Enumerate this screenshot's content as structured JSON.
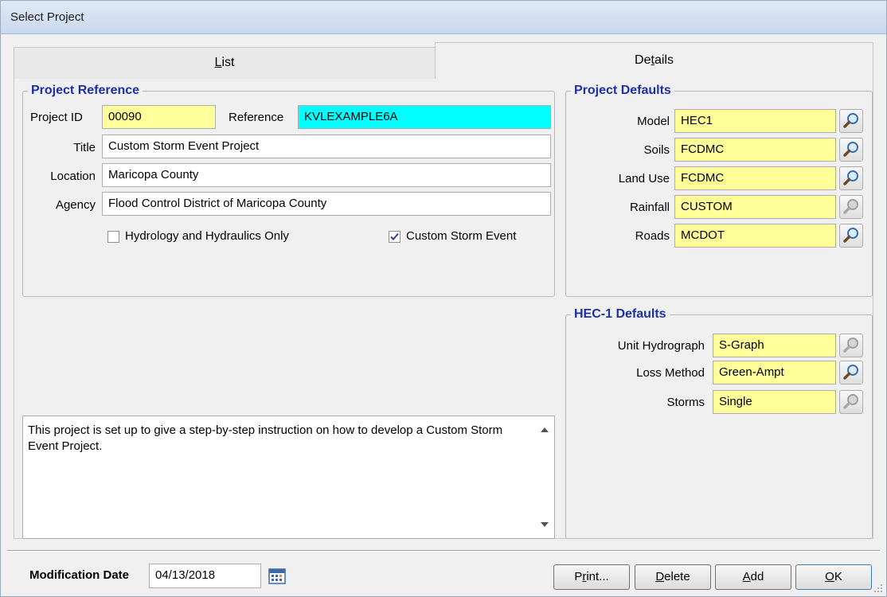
{
  "window": {
    "title": "Select Project"
  },
  "tabs": {
    "list": "List",
    "details": "Details"
  },
  "project_reference": {
    "legend": "Project Reference",
    "project_id_label": "Project ID",
    "project_id": "00090",
    "reference_label": "Reference",
    "reference": "KVLEXAMPLE6A",
    "title_label": "Title",
    "title": "Custom Storm Event Project",
    "location_label": "Location",
    "location": "Maricopa County",
    "agency_label": "Agency",
    "agency": "Flood Control District of Maricopa County",
    "hh_only_label": "Hydrology and Hydraulics Only",
    "hh_only_checked": false,
    "custom_storm_label": "Custom Storm Event",
    "custom_storm_checked": true
  },
  "project_defaults": {
    "legend": "Project Defaults",
    "rows": [
      {
        "label": "Model",
        "value": "HEC1",
        "lookup_enabled": true
      },
      {
        "label": "Soils",
        "value": "FCDMC",
        "lookup_enabled": true
      },
      {
        "label": "Land Use",
        "value": "FCDMC",
        "lookup_enabled": true
      },
      {
        "label": "Rainfall",
        "value": "CUSTOM",
        "lookup_enabled": false
      },
      {
        "label": "Roads",
        "value": "MCDOT",
        "lookup_enabled": true
      }
    ]
  },
  "hec1_defaults": {
    "legend": "HEC-1 Defaults",
    "rows": [
      {
        "label": "Unit Hydrograph",
        "value": "S-Graph",
        "lookup_enabled": false
      },
      {
        "label": "Loss Method",
        "value": "Green-Ampt",
        "lookup_enabled": true
      },
      {
        "label": "Storms",
        "value": "Single",
        "lookup_enabled": false
      }
    ]
  },
  "description": "This project is set up to give a step-by-step instruction on how to develop a Custom Storm Event Project.",
  "footer": {
    "modification_date_label": "Modification Date",
    "modification_date": "04/13/2018",
    "buttons": {
      "print": "Print...",
      "delete": "Delete",
      "add": "Add",
      "ok": "OK"
    }
  },
  "colors": {
    "required_field": "#ffff99",
    "key_field": "#00ffff",
    "legend_text": "#1f2fa8"
  },
  "icons": {
    "lookup": "magnifier-icon",
    "calendar": "calendar-icon",
    "scroll_up": "arrow-up-icon",
    "scroll_down": "arrow-down-icon"
  }
}
